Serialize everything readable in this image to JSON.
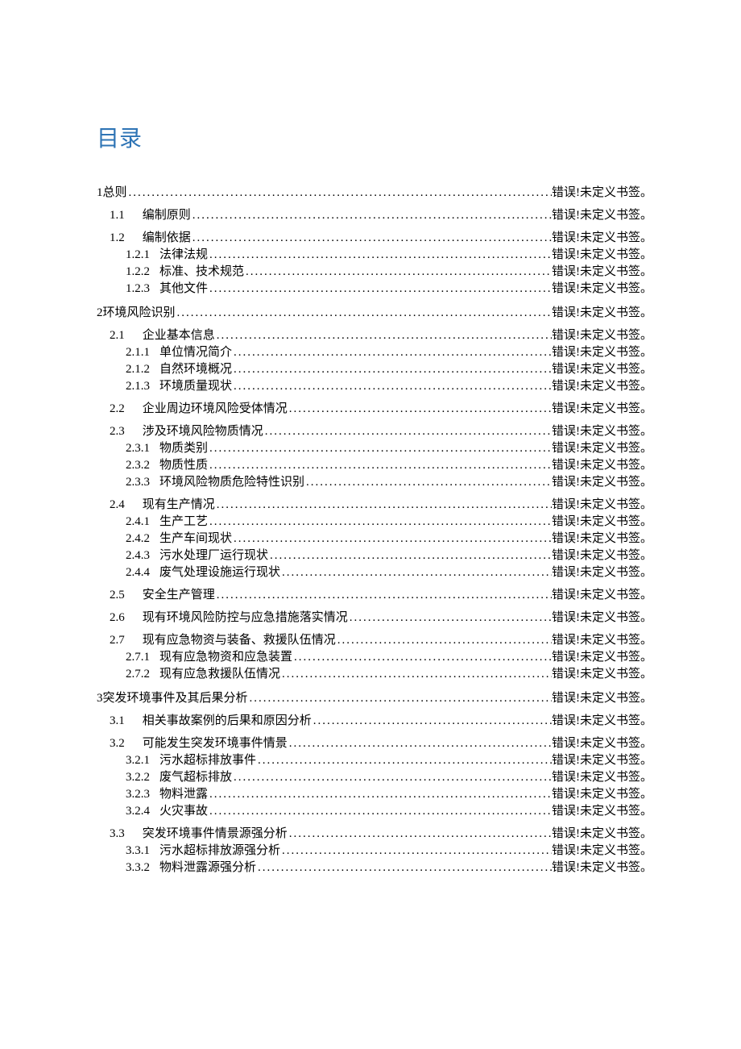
{
  "title": "目录",
  "page_ref": "错误!未定义书签。",
  "entries": [
    {
      "level": 1,
      "num": "1",
      "label": "总则"
    },
    {
      "level": 2,
      "num": "1.1",
      "label": "编制原则"
    },
    {
      "level": 2,
      "num": "1.2",
      "label": "编制依据"
    },
    {
      "level": 3,
      "num": "1.2.1",
      "label": "法律法规"
    },
    {
      "level": 3,
      "num": "1.2.2",
      "label": "标准、技术规范"
    },
    {
      "level": 3,
      "num": "1.2.3",
      "label": "其他文件"
    },
    {
      "level": 1,
      "num": "2",
      "label": "环境风险识别"
    },
    {
      "level": 2,
      "num": "2.1",
      "label": "企业基本信息"
    },
    {
      "level": 3,
      "num": "2.1.1",
      "label": "单位情况简介"
    },
    {
      "level": 3,
      "num": "2.1.2",
      "label": "自然环境概况"
    },
    {
      "level": 3,
      "num": "2.1.3",
      "label": "环境质量现状"
    },
    {
      "level": 2,
      "num": "2.2",
      "label": "企业周边环境风险受体情况"
    },
    {
      "level": 2,
      "num": "2.3",
      "label": "涉及环境风险物质情况"
    },
    {
      "level": 3,
      "num": "2.3.1",
      "label": "物质类别"
    },
    {
      "level": 3,
      "num": "2.3.2",
      "label": "物质性质"
    },
    {
      "level": 3,
      "num": "2.3.3",
      "label": "环境风险物质危险特性识别"
    },
    {
      "level": 2,
      "num": "2.4",
      "label": "现有生产情况"
    },
    {
      "level": 3,
      "num": "2.4.1",
      "label": "生产工艺"
    },
    {
      "level": 3,
      "num": "2.4.2",
      "label": "生产车间现状"
    },
    {
      "level": 3,
      "num": "2.4.3",
      "label": "污水处理厂运行现状"
    },
    {
      "level": 3,
      "num": "2.4.4",
      "label": "废气处理设施运行现状"
    },
    {
      "level": 2,
      "num": "2.5",
      "label": "安全生产管理"
    },
    {
      "level": 2,
      "num": "2.6",
      "label": "现有环境风险防控与应急措施落实情况"
    },
    {
      "level": 2,
      "num": "2.7",
      "label": "现有应急物资与装备、救援队伍情况"
    },
    {
      "level": 3,
      "num": "2.7.1",
      "label": "现有应急物资和应急装置"
    },
    {
      "level": 3,
      "num": "2.7.2",
      "label": "现有应急救援队伍情况"
    },
    {
      "level": 1,
      "num": "3",
      "label": "突发环境事件及其后果分析"
    },
    {
      "level": 2,
      "num": "3.1",
      "label": "相关事故案例的后果和原因分析"
    },
    {
      "level": 2,
      "num": "3.2",
      "label": "可能发生突发环境事件情景"
    },
    {
      "level": 3,
      "num": "3.2.1",
      "label": "污水超标排放事件"
    },
    {
      "level": 3,
      "num": "3.2.2",
      "label": "废气超标排放"
    },
    {
      "level": 3,
      "num": "3.2.3",
      "label": "物料泄露"
    },
    {
      "level": 3,
      "num": "3.2.4",
      "label": "火灾事故"
    },
    {
      "level": 2,
      "num": "3.3",
      "label": "突发环境事件情景源强分析"
    },
    {
      "level": 3,
      "num": "3.3.1",
      "label": "污水超标排放源强分析"
    },
    {
      "level": 3,
      "num": "3.3.2",
      "label": "物料泄露源强分析"
    }
  ]
}
